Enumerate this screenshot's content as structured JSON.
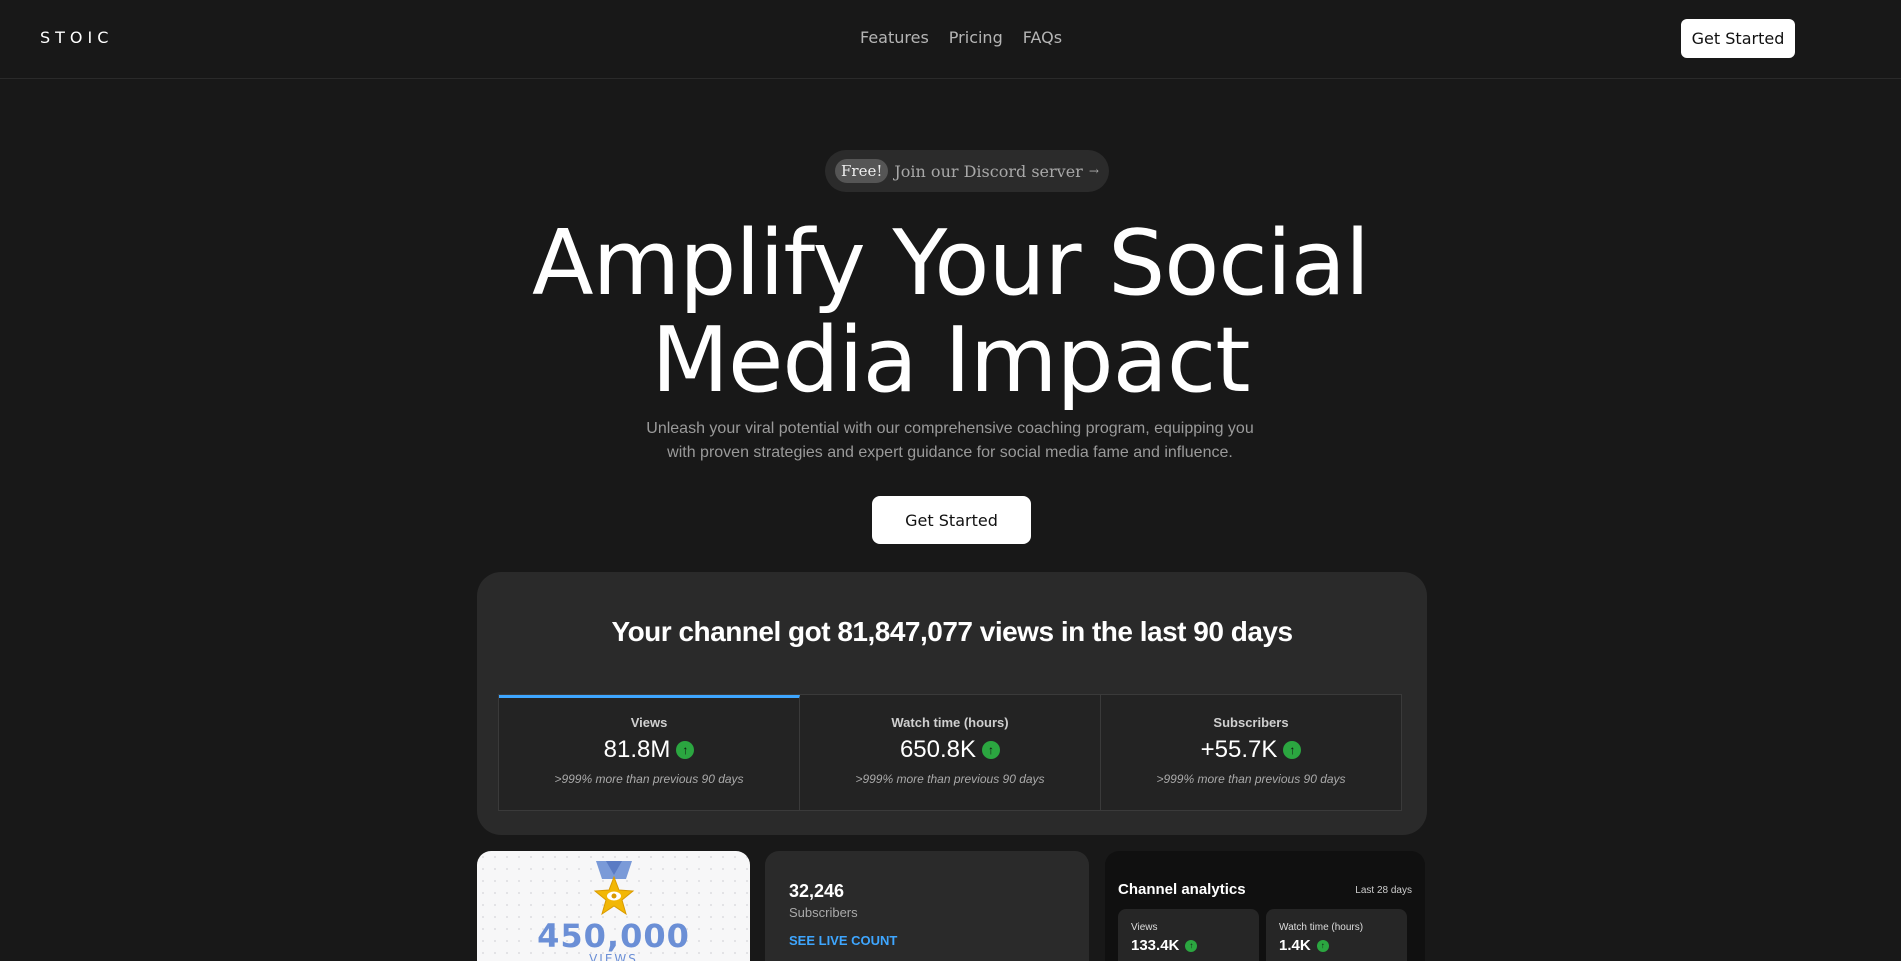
{
  "nav": {
    "logo": "STOIC",
    "links": [
      "Features",
      "Pricing",
      "FAQs"
    ],
    "cta": "Get Started"
  },
  "hero": {
    "badge": "Free!",
    "pill_text": "Join our Discord server",
    "title_line1": "Amplify Your Social",
    "title_line2": "Media Impact",
    "subtitle": "Unleash your viral potential with our comprehensive coaching program, equipping you with proven strategies and expert guidance for social media fame and influence.",
    "cta": "Get Started"
  },
  "stats": {
    "heading": "Your channel got 81,847,077 views in the last 90 days",
    "tiles": [
      {
        "label": "Views",
        "value": "81.8M",
        "note": ">999% more than previous 90 days"
      },
      {
        "label": "Watch time (hours)",
        "value": "650.8K",
        "note": ">999% more than previous 90 days"
      },
      {
        "label": "Subscribers",
        "value": "+55.7K",
        "note": ">999% more than previous 90 days"
      }
    ]
  },
  "award": {
    "number": "450,000",
    "label": "VIEWS"
  },
  "subscribers_card": {
    "number": "32,246",
    "label": "Subscribers",
    "link": "SEE LIVE COUNT"
  },
  "analytics": {
    "title": "Channel analytics",
    "range": "Last 28 days",
    "tiles": [
      {
        "label": "Views",
        "value": "133.4K"
      },
      {
        "label": "Watch time (hours)",
        "value": "1.4K"
      }
    ]
  },
  "colors": {
    "accent_blue": "#3ea6ff",
    "up_green": "#2ba640",
    "award_blue": "#6b8fd6"
  }
}
